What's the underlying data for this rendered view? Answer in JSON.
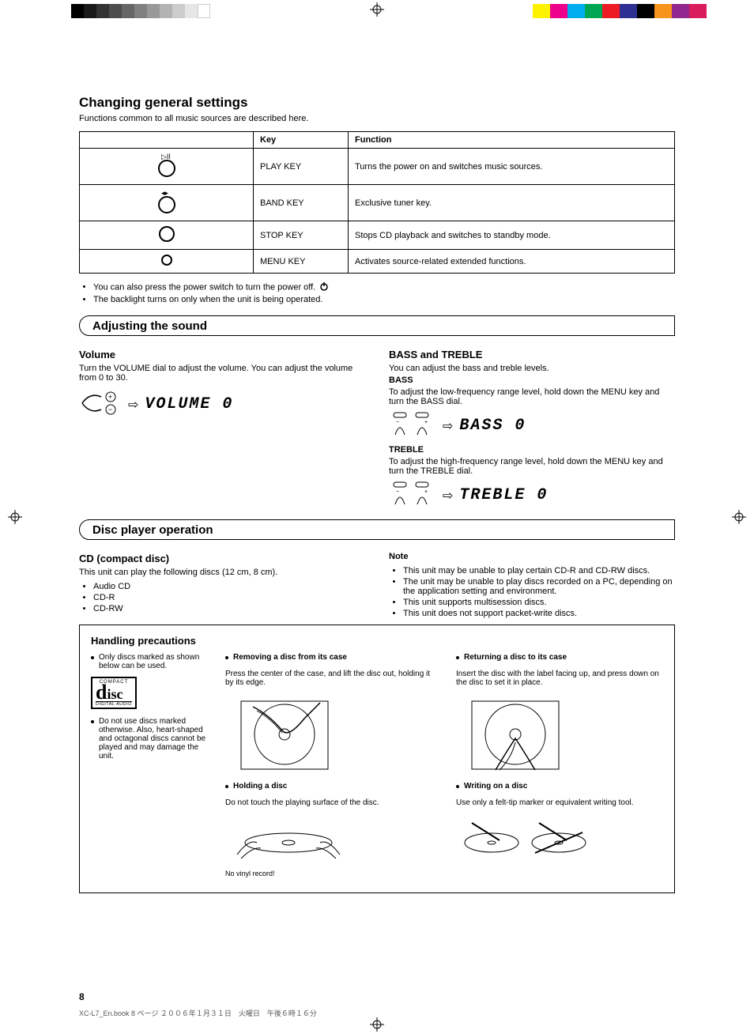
{
  "title": "Changing general settings",
  "intro": "Functions common to all music sources are described here.",
  "table": {
    "headers": [
      "",
      "Key",
      "Function"
    ],
    "rows": [
      {
        "key": "PLAY KEY",
        "func": "Turns the power on and switches music sources."
      },
      {
        "key": "BAND KEY",
        "func": "Exclusive tuner key."
      },
      {
        "key": "STOP KEY",
        "func": "Stops CD playback and switches to standby mode."
      },
      {
        "key": "MENU KEY",
        "func": "Activates source-related extended functions."
      }
    ]
  },
  "bulletsA": [
    "You can also press the power switch to turn the power off.",
    "The backlight turns on only when the unit is being operated."
  ],
  "sectionA": "Adjusting the sound",
  "volume": {
    "heading": "Volume",
    "text": "Turn the VOLUME dial to adjust the volume. You can adjust the volume from 0 to 30.",
    "lcd": "VOLUME 0"
  },
  "bassTreble": {
    "heading": "BASS and TREBLE",
    "intro": "You can adjust the bass and treble levels.",
    "bass_h": "BASS",
    "bass_t": "To adjust the low-frequency range level, hold down the MENU key and turn the BASS dial.",
    "bass_lcd": "BASS  0",
    "treble_h": "TREBLE",
    "treble_t": "To adjust the high-frequency range level, hold down the MENU key and turn the TREBLE dial.",
    "treble_lcd": "TREBLE 0"
  },
  "sectionB": "Disc player operation",
  "cdInfo": {
    "heading": "CD (compact disc)",
    "text": "This unit can play the following discs (12 cm, 8 cm).",
    "items": [
      "Audio CD",
      "CD-R",
      "CD-RW"
    ],
    "noteHead": "Note",
    "notes": [
      "This unit may be unable to play certain CD-R and CD-RW discs.",
      "The unit may be unable to play discs recorded on a PC, depending on the application setting and environment.",
      "This unit supports multisession discs.",
      "This unit does not support packet-write discs."
    ]
  },
  "discBox": {
    "head": "Handling precautions",
    "left1": "Only discs marked as shown below can be used.",
    "left2": "Do not use discs marked otherwise. Also, heart-shaped and octagonal discs cannot be played and may damage the unit.",
    "r1h": "Removing a disc from its case",
    "r1t": "Press the center of the case, and lift the disc out, holding it by its edge.",
    "r2h": "Returning a disc to its case",
    "r2t": "Insert the disc with the label facing up, and press down on the disc to set it in place.",
    "r3h": "Holding a disc",
    "r3t": "Do not touch the playing surface of the disc.",
    "r4h": "Writing on a disc",
    "r4t": "Use only a felt-tip marker or equivalent writing tool.",
    "novinyl": "No vinyl record!"
  },
  "pageNum": "8",
  "footer": {
    "file": "XC-L7_En.book  8 ページ  ２００６年１月３１日　火曜日　午後６時１６分"
  },
  "colors": {
    "grays": [
      "#000",
      "#1a1a1a",
      "#333",
      "#4d4d4d",
      "#666",
      "#808080",
      "#999",
      "#b3b3b3",
      "#ccc",
      "#e6e6e6",
      "#fff"
    ],
    "cmyk": [
      "#00aeef",
      "#ec008c",
      "#fff200",
      "#000000",
      "#00a651",
      "#ed1c24",
      "#2e3192",
      "#f7941d",
      "#92278f",
      "#d91c5c"
    ]
  }
}
